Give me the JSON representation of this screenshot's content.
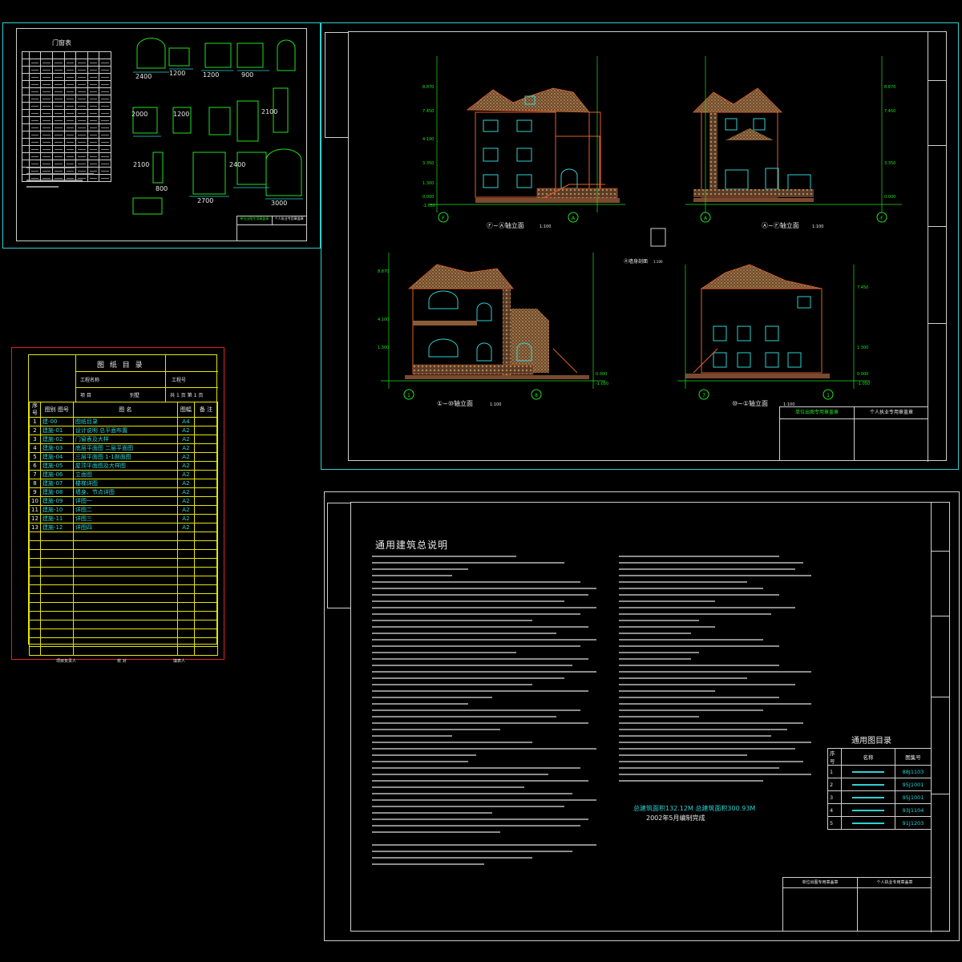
{
  "sheet_door": {
    "title": "门窗表",
    "dims": [
      "2400",
      "1200",
      "1200",
      "900",
      "2100",
      "2000",
      "1200",
      "2100",
      "2400",
      "2700",
      "3000",
      "800",
      "2100"
    ],
    "footer_left": "单位出图专用章盖章",
    "footer_right": "个人执业专用章盖章"
  },
  "sheet_elev": {
    "views": [
      {
        "label": "Ⓕ~Ⓐ轴立面",
        "scale": "1:100"
      },
      {
        "label": "Ⓐ~Ⓕ轴立面",
        "scale": "1:100"
      },
      {
        "label": "①~⑩轴立面",
        "scale": "1:100"
      },
      {
        "label": "⑩~①轴立面",
        "scale": "1:100"
      }
    ],
    "section_label": "Ⓐ墙身剖面",
    "section_scale": "1:100",
    "axis_marks": [
      "F",
      "A",
      "A",
      "F",
      "1",
      "8",
      "7",
      "1"
    ],
    "levels": [
      "8.870",
      "7.450",
      "4.100",
      "3.350",
      "1.300",
      "0.000",
      "-1.050"
    ],
    "footer_left": "单位出图专用章盖章",
    "footer_right": "个人执业专用章盖章"
  },
  "catalog": {
    "title": "图 纸 目 录",
    "project_label": "工程名称",
    "item_label": "项 目",
    "item_value": "别墅",
    "job_label": "工程号",
    "page_label_1": "共",
    "page_label_2": "页",
    "page_label_3": "第",
    "page_value": "1",
    "headers": [
      "序号",
      "图别 图号",
      "图 名",
      "图幅",
      "备 注"
    ],
    "rows": [
      {
        "n": "1",
        "code": "建-00",
        "name": "图纸目录",
        "size": "A4"
      },
      {
        "n": "2",
        "code": "建施-01",
        "name": "设计说明 总平面布置",
        "size": "A2"
      },
      {
        "n": "3",
        "code": "建施-02",
        "name": "门窗表及大样",
        "size": "A2"
      },
      {
        "n": "4",
        "code": "建施-03",
        "name": "底层平面图 二层平面图",
        "size": "A2"
      },
      {
        "n": "5",
        "code": "建施-04",
        "name": "三层平面图 1-1剖面图",
        "size": "A2"
      },
      {
        "n": "6",
        "code": "建施-05",
        "name": "屋顶平面图及大样图",
        "size": "A2"
      },
      {
        "n": "7",
        "code": "建施-06",
        "name": "立面图",
        "size": "A2"
      },
      {
        "n": "8",
        "code": "建施-07",
        "name": "楼梯详图",
        "size": "A2"
      },
      {
        "n": "9",
        "code": "建施-08",
        "name": "墙身、节点详图",
        "size": "A2"
      },
      {
        "n": "10",
        "code": "建施-09",
        "name": "详图一",
        "size": "A2"
      },
      {
        "n": "11",
        "code": "建施-10",
        "name": "详图二",
        "size": "A2"
      },
      {
        "n": "12",
        "code": "建施-11",
        "name": "详图三",
        "size": "A2"
      },
      {
        "n": "13",
        "code": "建施-12",
        "name": "详图四",
        "size": "A2"
      }
    ],
    "footer": [
      "项目负责人",
      "校 对",
      "填表人"
    ]
  },
  "notes": {
    "title": "通用建筑总说明",
    "area_text": "总建筑面积132.12M  总建筑面积300.93M",
    "date_text": "2002年5月编制完成",
    "std_title": "通用图目录",
    "std_headers": [
      "序号",
      "名称",
      "图集号"
    ],
    "std_rows": [
      {
        "n": "1",
        "code": "88J1103"
      },
      {
        "n": "2",
        "code": "95J1001"
      },
      {
        "n": "3",
        "code": "95J1001"
      },
      {
        "n": "4",
        "code": "93J1104"
      },
      {
        "n": "5",
        "code": "91J1203"
      }
    ],
    "footer_left": "单位出图专用章盖章",
    "footer_right": "个人执业专用章盖章"
  }
}
